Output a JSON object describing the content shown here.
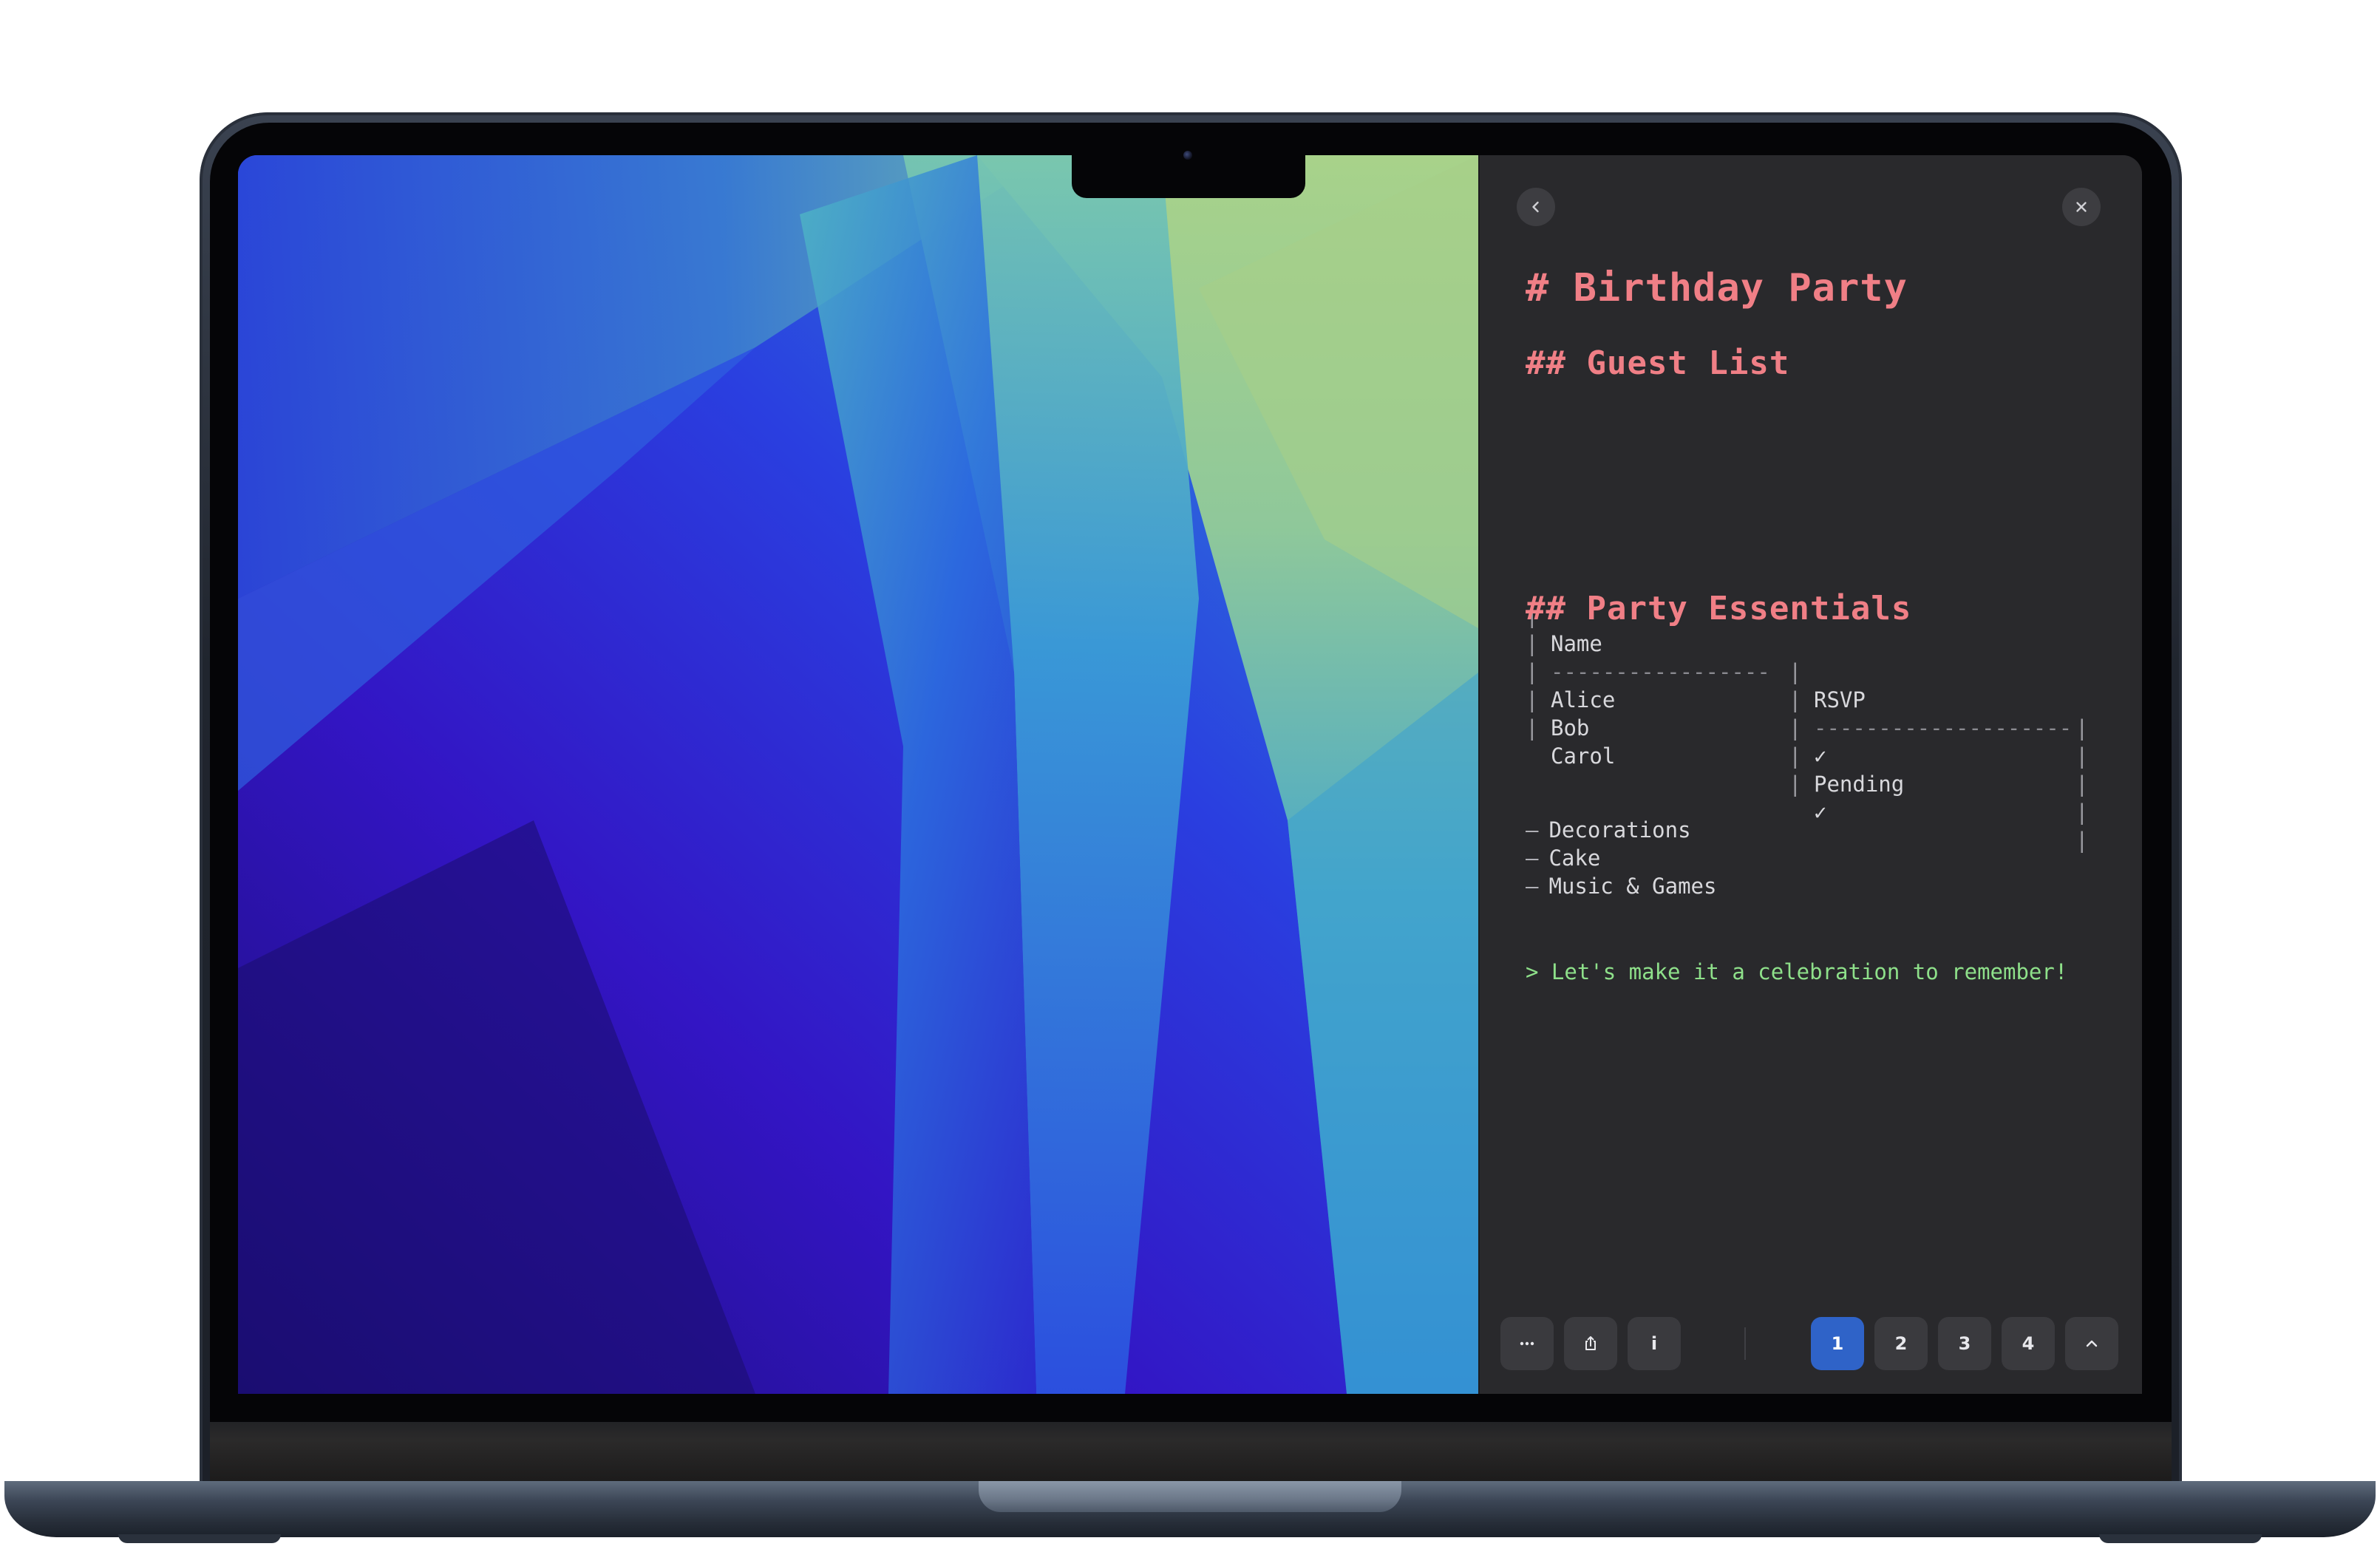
{
  "document": {
    "title": "# Birthday Party",
    "guest_heading": "## Guest List",
    "table": {
      "headers": [
        "Name",
        "RSVP"
      ],
      "separator": [
        "-----------------",
        "--------------------"
      ],
      "rows": [
        [
          "Alice",
          "✓"
        ],
        [
          "Bob",
          "Pending"
        ],
        [
          "Carol",
          "✓"
        ]
      ]
    },
    "essentials_heading": "## Party Essentials",
    "essentials": [
      "Decorations",
      "Cake",
      "Music & Games"
    ],
    "list_bullet": "–",
    "table_pipe": "|",
    "quote": "> Let's make it a celebration to remember!"
  },
  "toolbar": {
    "info_label": "i",
    "pages": [
      "1",
      "2",
      "3",
      "4"
    ],
    "active_page": "1"
  },
  "icons": {
    "back": "chevron-left-icon",
    "close": "close-icon",
    "more": "ellipsis-icon",
    "share": "share-icon",
    "info": "info-icon",
    "collapse": "chevron-up-icon"
  },
  "colors": {
    "heading": "#f07f86",
    "quote": "#8ee08a",
    "panel_bg": "#29292c",
    "active_page": "#2f63c8"
  }
}
